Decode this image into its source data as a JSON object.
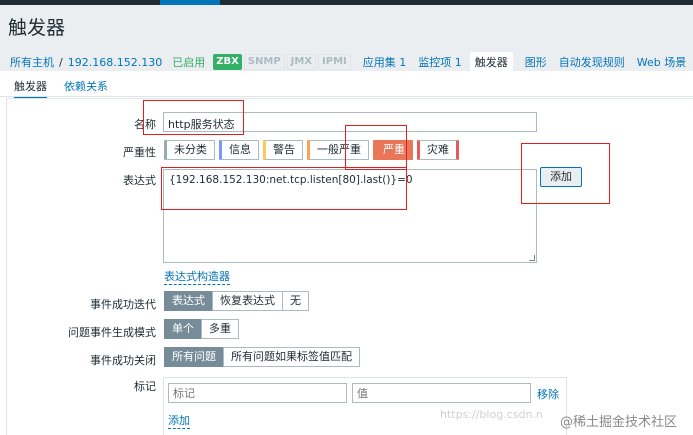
{
  "page": {
    "title": "触发器"
  },
  "breadcrumb": {
    "all_hosts": "所有主机",
    "separator": "/",
    "host": "192.168.152.130",
    "status": "已启用"
  },
  "availability": {
    "zbx": "ZBX",
    "snmp": "SNMP",
    "jmx": "JMX",
    "ipmi": "IPMI"
  },
  "host_nav": [
    {
      "label": "应用集 1"
    },
    {
      "label": "监控项 1"
    },
    {
      "label": "触发器"
    },
    {
      "label": "图形"
    },
    {
      "label": "自动发现规则"
    },
    {
      "label": "Web 场景"
    }
  ],
  "tabs": {
    "trigger": "触发器",
    "dependencies": "依赖关系"
  },
  "form": {
    "name_label": "名称",
    "name_value": "http服务状态",
    "severity_label": "严重性",
    "severities": [
      "未分类",
      "信息",
      "警告",
      "一般严重",
      "严重",
      "灾难"
    ],
    "severity_selected": "严重",
    "expression_label": "表达式",
    "expression_value": "{192.168.152.130:net.tcp.listen[80].last()}=0",
    "add_button": "添加",
    "expression_constructor": "表达式构造器",
    "ok_event_label": "事件成功迭代",
    "ok_event_options": [
      "表达式",
      "恢复表达式",
      "无"
    ],
    "ok_event_selected": "表达式",
    "problem_mode_label": "问题事件生成模式",
    "problem_mode_options": [
      "单个",
      "多重"
    ],
    "problem_mode_selected": "单个",
    "ok_close_label": "事件成功关闭",
    "ok_close_options": [
      "所有问题",
      "所有问题如果标签值匹配"
    ],
    "ok_close_selected": "所有问题",
    "tags_label": "标记",
    "tag_placeholder": "标记",
    "value_placeholder": "值",
    "remove_link": "移除",
    "add_link": "添加"
  },
  "watermarks": {
    "csdn": "https://blog.csdn.n",
    "juejin": "@稀土掘金技术社区"
  },
  "colors": {
    "accent": "#0275b8",
    "zbx_green": "#34af67",
    "high": "#e97659",
    "annotation_red": "#e02020"
  }
}
